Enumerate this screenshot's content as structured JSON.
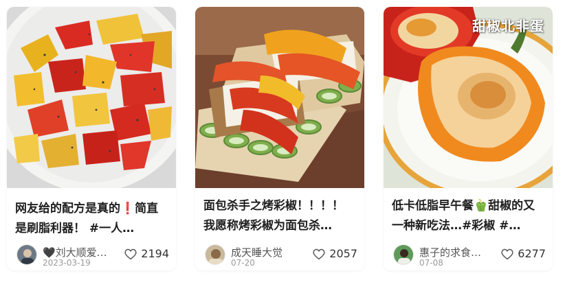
{
  "colors": {
    "card_bg": "#ffffff",
    "title_text": "#1f1f1f",
    "meta_text": "#555555",
    "date_text": "#9a9a9a",
    "heart_outline": "#555555"
  },
  "posts": [
    {
      "title": "网友给的配方是真的❗️简直是刷脂利器！ #一人…",
      "author": "🖤刘大顺爱…",
      "date": "2023-03-19",
      "likes": "2194",
      "image": "roasted-pepper-bowl-photo",
      "watermark": ""
    },
    {
      "title": "面包杀手之烤彩椒！！！！ 我愿称烤彩椒为面包杀…",
      "author": "成天睡大觉",
      "date": "07-20",
      "likes": "2057",
      "image": "pepper-toast-photo",
      "watermark": ""
    },
    {
      "title": "低卡低脂早午餐🫑甜椒的又一种新吃法…#彩椒 #…",
      "author": "惠子的求食…",
      "date": "07-08",
      "likes": "6277",
      "image": "stuffed-pepper-egg-photo",
      "watermark": "甜椒北非蛋"
    }
  ],
  "icons": {
    "like": "heart-outline-icon"
  }
}
